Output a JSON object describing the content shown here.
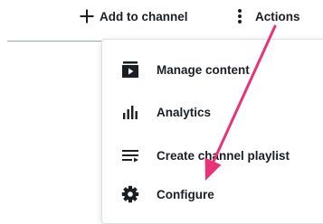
{
  "toolbar": {
    "add_label": "Add to channel",
    "actions_label": "Actions"
  },
  "menu": {
    "items": [
      {
        "label": "Manage content",
        "icon": "play-box-icon"
      },
      {
        "label": "Analytics",
        "icon": "bar-chart-icon"
      },
      {
        "label": "Create channel playlist",
        "icon": "playlist-add-icon"
      },
      {
        "label": "Configure",
        "icon": "gear-icon"
      }
    ]
  },
  "colors": {
    "text": "#1b1f24",
    "annotation_arrow": "#e6337a",
    "divider": "#9aa4ce",
    "menu_border": "#dde0e5"
  }
}
